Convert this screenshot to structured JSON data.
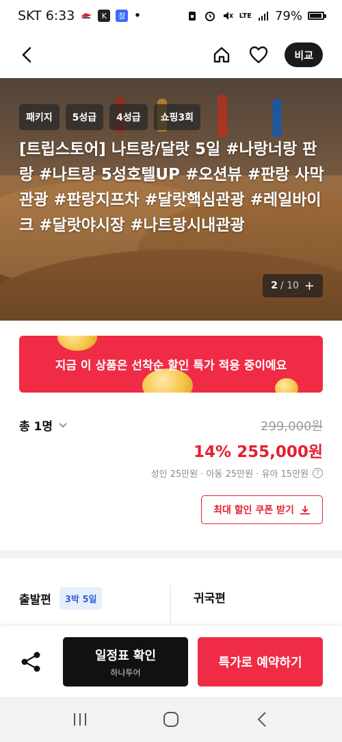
{
  "status_bar": {
    "carrier_time": "SKT 6:33",
    "dot": "•",
    "battery": "79%",
    "network": "LTE"
  },
  "nav": {
    "compare_label": "비교"
  },
  "hero": {
    "tags": [
      "패키지",
      "5성급",
      "4성급",
      "쇼핑3회"
    ],
    "title": "[트립스토어] 나트랑/달랏 5일 #나랑너랑 판랑 #나트랑 5성호텔UP #오션뷰 #판랑 사막관광 #판랑지프차 #달랏핵심관광 #레일바이크 #달랏야시장 #나트랑시내관광",
    "pager_current": "2",
    "pager_total": "/ 10",
    "pager_plus": "+"
  },
  "promo": {
    "text": "지금 이 상품은 선착순 할인 특가 적용 중이에요"
  },
  "price": {
    "people_label": "총 1명",
    "original": "299,000원",
    "discount_pct": "14%",
    "sale": "255,000원",
    "breakdown": "성인 25만원 · 아동 25만원 · 유아 15만원",
    "coupon_label": "최대 할인 쿠폰 받기"
  },
  "flight": {
    "outbound_label": "출발편",
    "duration_badge": "3박 5일",
    "inbound_label": "귀국편"
  },
  "actions": {
    "schedule_label": "일정표 확인",
    "schedule_sub": "하나투어",
    "book_label": "특가로 예약하기"
  },
  "colors": {
    "accent_red": "#ef2b45",
    "price_red": "#e4202f",
    "badge_blue": "#2f5fd6"
  }
}
